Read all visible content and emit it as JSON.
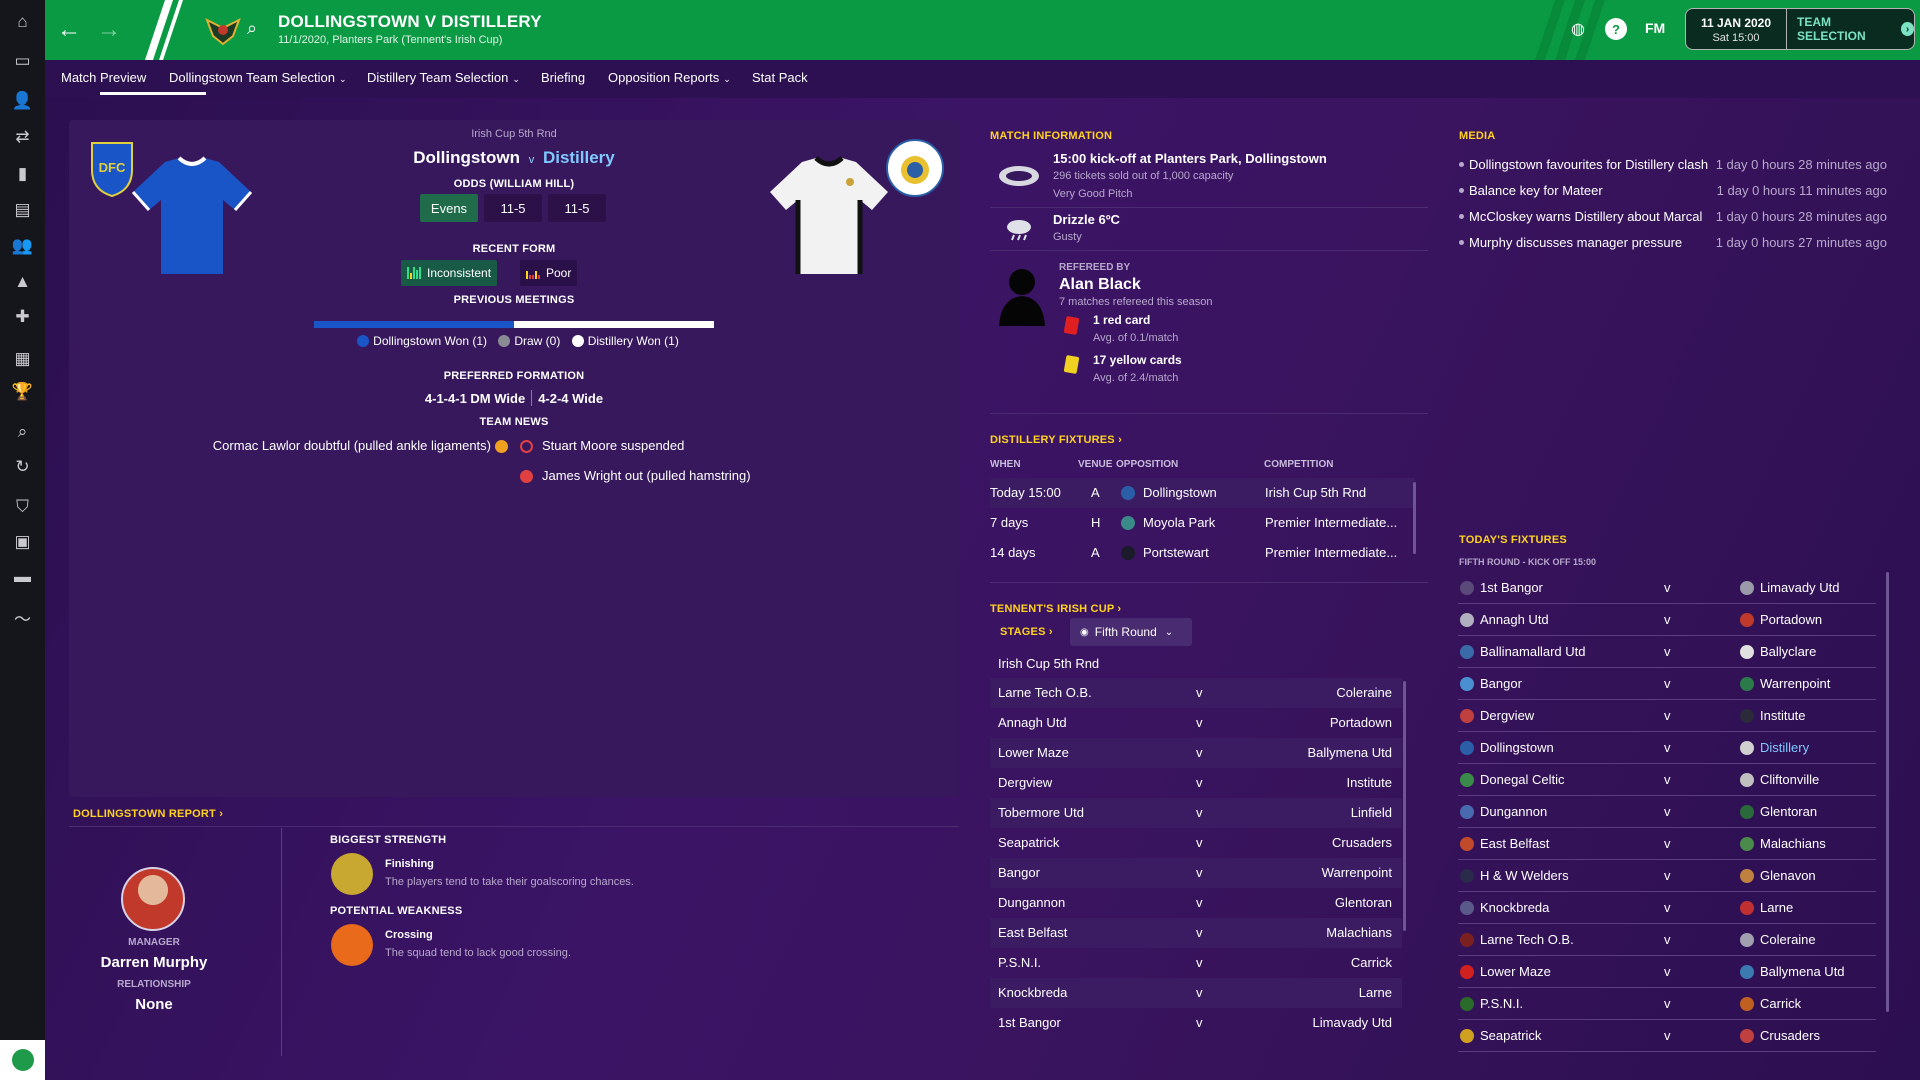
{
  "sidebar": {
    "items": [
      {
        "icon": "home-icon",
        "glyph": "⌂"
      },
      {
        "icon": "inbox-icon",
        "glyph": "▭"
      },
      {
        "icon": "squad-icon",
        "glyph": "👤"
      },
      {
        "icon": "tactics-icon",
        "glyph": "⇄"
      },
      {
        "icon": "dynamics-icon",
        "glyph": "▮"
      },
      {
        "icon": "reports-icon",
        "glyph": "▤"
      },
      {
        "icon": "staff-icon",
        "glyph": "👥"
      },
      {
        "icon": "training-icon",
        "glyph": "▲"
      },
      {
        "icon": "medical-icon",
        "glyph": "✚"
      },
      {
        "icon": "schedule-icon",
        "glyph": "▦"
      },
      {
        "icon": "competitions-icon",
        "glyph": "🏆"
      },
      {
        "icon": "scouting-icon",
        "glyph": "⌕"
      },
      {
        "icon": "transfers-icon",
        "glyph": "↻"
      },
      {
        "icon": "club-info-icon",
        "glyph": "⛉"
      },
      {
        "icon": "club-vision-icon",
        "glyph": "▣"
      },
      {
        "icon": "finances-icon",
        "glyph": "▬"
      },
      {
        "icon": "dev-centre-icon",
        "glyph": "〜"
      }
    ]
  },
  "header": {
    "title": "DOLLINGSTOWN V DISTILLERY",
    "subtitle": "11/1/2020, Planters Park (Tennent's Irish Cup)",
    "fm_label": "FM",
    "date": "11 JAN 2020",
    "time": "Sat 15:00",
    "continue_label": "TEAM SELECTION"
  },
  "tabs": [
    {
      "label": "Match Preview",
      "dropdown": false
    },
    {
      "label": "Dollingstown Team Selection",
      "dropdown": true
    },
    {
      "label": "Distillery Team Selection",
      "dropdown": true
    },
    {
      "label": "Briefing",
      "dropdown": false
    },
    {
      "label": "Opposition Reports",
      "dropdown": true
    },
    {
      "label": "Stat Pack",
      "dropdown": false
    }
  ],
  "preview": {
    "competition": "Irish Cup 5th Rnd",
    "home_team": "Dollingstown",
    "vs": "v",
    "away_team": "Distillery",
    "odds_label": "ODDS (WILLIAM HILL)",
    "odds": [
      "Evens",
      "11-5",
      "11-5"
    ],
    "recent_form_label": "RECENT FORM",
    "home_form": "Inconsistent",
    "away_form": "Poor",
    "previous_meetings_label": "PREVIOUS MEETINGS",
    "meetings": {
      "home_won": 1,
      "draw": 0,
      "away_won": 1
    },
    "meetings_legend": [
      "Dollingstown Won (1)",
      "Draw (0)",
      "Distillery Won (1)"
    ],
    "formation_label": "PREFERRED FORMATION",
    "home_formation": "4-1-4-1 DM Wide",
    "away_formation": "4-2-4 Wide",
    "team_news_label": "TEAM NEWS",
    "home_news": [
      "Cormac Lawlor doubtful (pulled ankle ligaments)"
    ],
    "away_news": [
      "Stuart Moore suspended",
      "James Wright out (pulled hamstring)"
    ]
  },
  "report": {
    "title": "DOLLINGSTOWN REPORT",
    "manager_label": "MANAGER",
    "manager_name": "Darren Murphy",
    "relationship_label": "RELATIONSHIP",
    "relationship_value": "None",
    "strength_label": "BIGGEST STRENGTH",
    "strength_name": "Finishing",
    "strength_desc": "The players tend to take their goalscoring chances.",
    "weakness_label": "POTENTIAL WEAKNESS",
    "weakness_name": "Crossing",
    "weakness_desc": "The squad tend to lack good crossing."
  },
  "match_info": {
    "title": "MATCH INFORMATION",
    "kickoff": "15:00 kick-off at Planters Park, Dollingstown",
    "tickets": "296 tickets sold out of 1,000 capacity",
    "pitch": "Very Good Pitch",
    "weather": "Drizzle 6ºC",
    "wind": "Gusty",
    "refereed_by_label": "REFEREED BY",
    "referee": "Alan Black",
    "ref_matches": "7 matches refereed this season",
    "red_cards": "1 red card",
    "red_avg": "Avg. of 0.1/match",
    "yellow_cards": "17 yellow cards",
    "yellow_avg": "Avg. of 2.4/match"
  },
  "distillery_fixtures": {
    "title": "DISTILLERY FIXTURES",
    "headers": [
      "WHEN",
      "VENUE",
      "OPPOSITION",
      "COMPETITION"
    ],
    "rows": [
      {
        "when": "Today 15:00",
        "venue": "A",
        "opp": "Dollingstown",
        "comp": "Irish Cup 5th Rnd",
        "badge": "#2a5fa8"
      },
      {
        "when": "7 days",
        "venue": "H",
        "opp": "Moyola Park",
        "comp": "Premier Intermediate...",
        "badge": "#3a8a8a"
      },
      {
        "when": "14 days",
        "venue": "A",
        "opp": "Portstewart",
        "comp": "Premier Intermediate...",
        "badge": "#1a1a2a"
      }
    ]
  },
  "cup": {
    "title": "TENNENT'S IRISH CUP",
    "stages_label": "STAGES",
    "stage_value": "Fifth Round",
    "round_label": "Irish Cup 5th Rnd",
    "matches": [
      {
        "home": "Larne Tech O.B.",
        "v": "v",
        "away": "Coleraine"
      },
      {
        "home": "Annagh Utd",
        "v": "v",
        "away": "Portadown"
      },
      {
        "home": "Lower Maze",
        "v": "v",
        "away": "Ballymena Utd"
      },
      {
        "home": "Dergview",
        "v": "v",
        "away": "Institute"
      },
      {
        "home": "Tobermore Utd",
        "v": "v",
        "away": "Linfield"
      },
      {
        "home": "Seapatrick",
        "v": "v",
        "away": "Crusaders"
      },
      {
        "home": "Bangor",
        "v": "v",
        "away": "Warrenpoint"
      },
      {
        "home": "Dungannon",
        "v": "v",
        "away": "Glentoran"
      },
      {
        "home": "East Belfast",
        "v": "v",
        "away": "Malachians"
      },
      {
        "home": "P.S.N.I.",
        "v": "v",
        "away": "Carrick"
      },
      {
        "home": "Knockbreda",
        "v": "v",
        "away": "Larne"
      },
      {
        "home": "1st Bangor",
        "v": "v",
        "away": "Limavady Utd"
      }
    ]
  },
  "media": {
    "title": "MEDIA",
    "items": [
      {
        "headline": "Dollingstown favourites for Distillery clash",
        "time": "1 day 0 hours 28 minutes ago"
      },
      {
        "headline": "Balance key for Mateer",
        "time": "1 day 0 hours 11 minutes ago"
      },
      {
        "headline": "McCloskey warns Distillery about Marcal",
        "time": "1 day 0 hours 28 minutes ago"
      },
      {
        "headline": "Murphy discusses manager pressure",
        "time": "1 day 0 hours 27 minutes ago"
      }
    ]
  },
  "todays_fixtures": {
    "title": "TODAY'S FIXTURES",
    "subtitle": "FIFTH ROUND - KICK OFF 15:00",
    "rows": [
      {
        "home": "1st Bangor",
        "v": "v",
        "away": "Limavady Utd",
        "hb": "#5a4a7a",
        "ab": "#9a9aa8"
      },
      {
        "home": "Annagh Utd",
        "v": "v",
        "away": "Portadown",
        "hb": "#b0b0c0",
        "ab": "#c0392b"
      },
      {
        "home": "Ballinamallard Utd",
        "v": "v",
        "away": "Ballyclare",
        "hb": "#3a6aa8",
        "ab": "#e0e0e0"
      },
      {
        "home": "Bangor",
        "v": "v",
        "away": "Warrenpoint",
        "hb": "#4a90d0",
        "ab": "#2a7a4a"
      },
      {
        "home": "Dergview",
        "v": "v",
        "away": "Institute",
        "hb": "#c04040",
        "ab": "#2a2a3a"
      },
      {
        "home": "Dollingstown",
        "v": "v",
        "away": "Distillery",
        "hb": "#2a5fa8",
        "ab": "#d0d0d0",
        "highlight_away": true
      },
      {
        "home": "Donegal Celtic",
        "v": "v",
        "away": "Cliftonville",
        "hb": "#3a8a4a",
        "ab": "#c0c0c0"
      },
      {
        "home": "Dungannon",
        "v": "v",
        "away": "Glentoran",
        "hb": "#4a6ab0",
        "ab": "#2a6a3a"
      },
      {
        "home": "East Belfast",
        "v": "v",
        "away": "Malachians",
        "hb": "#c04a2a",
        "ab": "#4a8a4a"
      },
      {
        "home": "H & W Welders",
        "v": "v",
        "away": "Glenavon",
        "hb": "#2a2a4a",
        "ab": "#c08040"
      },
      {
        "home": "Knockbreda",
        "v": "v",
        "away": "Larne",
        "hb": "#5a5a8a",
        "ab": "#c03030"
      },
      {
        "home": "Larne Tech O.B.",
        "v": "v",
        "away": "Coleraine",
        "hb": "#7a2020",
        "ab": "#a0a0b0"
      },
      {
        "home": "Lower Maze",
        "v": "v",
        "away": "Ballymena Utd",
        "hb": "#d02020",
        "ab": "#3a7ab0"
      },
      {
        "home": "P.S.N.I.",
        "v": "v",
        "away": "Carrick",
        "hb": "#2a6a2a",
        "ab": "#c06020"
      },
      {
        "home": "Seapatrick",
        "v": "v",
        "away": "Crusaders",
        "hb": "#d0a020",
        "ab": "#c04040"
      }
    ]
  },
  "colors": {
    "header_green": "#0a9a44",
    "accent_yellow": "#ffd21f",
    "home_blue": "#1a55c8",
    "away_white": "#ffffff",
    "highlight_link": "#7fc9ff"
  }
}
